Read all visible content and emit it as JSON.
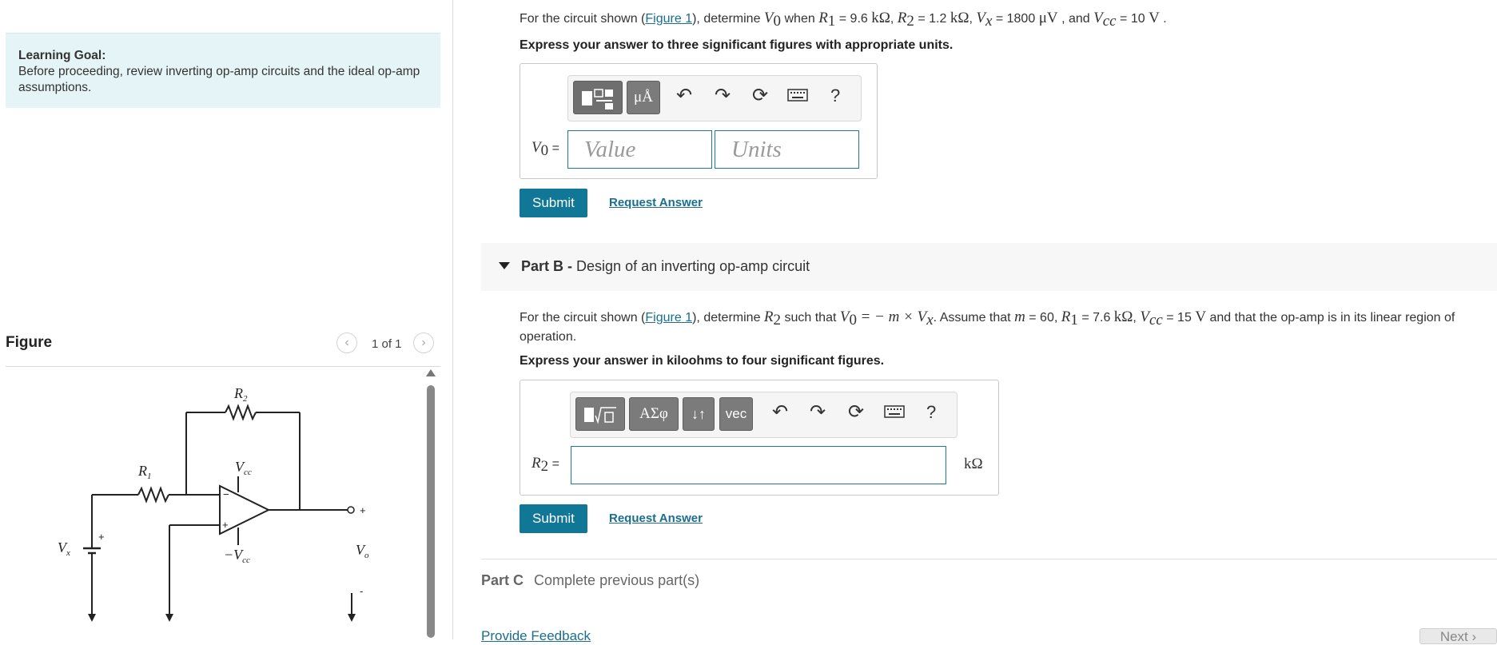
{
  "learning_goal": {
    "title": "Learning Goal:",
    "text": "Before proceeding, review inverting op-amp circuits and the ideal op-amp assumptions."
  },
  "figure": {
    "title": "Figure",
    "counter": "1 of 1",
    "prev_icon": "chevron-left-icon",
    "next_icon": "chevron-right-icon",
    "circuit_labels": {
      "r2": "R",
      "r2_sub": "2",
      "r1": "R",
      "r1_sub": "1",
      "vcc": "V",
      "vcc_sub": "cc",
      "neg_vcc": "−V",
      "neg_vcc_sub": "cc",
      "vx": "V",
      "vx_sub": "x",
      "vo": "V",
      "vo_sub": "o",
      "plus": "+",
      "minus": "−",
      "out_plus": "+",
      "out_minus": "-"
    }
  },
  "part_a": {
    "p_pre": "For the circuit shown (",
    "figure_link": "Figure 1",
    "p_post": "), determine",
    "v0": "V",
    "v0_sub": "0",
    "when": "when",
    "r1": "R",
    "r1_sub": "1",
    "r1_val": "= 9.6",
    "k_ohm": "kΩ",
    "comma": ",",
    "r2": "R",
    "r2_sub": "2",
    "r2_val": "= 1.2",
    "vx": "V",
    "vx_sub": "x",
    "vx_val": "= 1800",
    "micro_v": "μV",
    "and": ", and",
    "vcc": "V",
    "vcc_sub": "cc",
    "vcc_val": "= 10",
    "volt": "V",
    "period": ".",
    "instruction": "Express your answer to three significant figures with appropriate units.",
    "toolbar": {
      "templates_icon": "templates-icon",
      "units_label": "μÅ",
      "undo_icon": "undo-icon",
      "redo_icon": "redo-icon",
      "reset_icon": "reset-icon",
      "keyboard_icon": "keyboard-icon",
      "help_label": "?"
    },
    "label": "V",
    "label_sub": "0",
    "label_eq": "=",
    "value_placeholder": "Value",
    "units_placeholder": "Units",
    "submit_label": "Submit",
    "request_label": "Request Answer"
  },
  "part_b": {
    "header_bold": "Part B -",
    "header_text": "Design of an inverting op-amp circuit",
    "p_pre": "For the circuit shown (",
    "figure_link": "Figure 1",
    "p_post": "), determine",
    "r2": "R",
    "r2_sub": "2",
    "such_that": "such that",
    "v0": "V",
    "v0_sub": "0",
    "eq_expr": "= − m × V",
    "eq_sub": "x",
    "eq_end": ".",
    "assume": "Assume that",
    "m": "m",
    "m_val": "= 60,",
    "r1": "R",
    "r1_sub": "1",
    "r1_val": "= 7.6",
    "k_ohm": "kΩ",
    "comma": ",",
    "vcc": "V",
    "vcc_sub": "cc",
    "vcc_val": "= 15",
    "volt": "V",
    "tail": "and that the op-amp is in its linear region of operation.",
    "instruction": "Express your answer in kiloohms to four significant figures.",
    "toolbar": {
      "templates_icon": "templates-icon",
      "symbols_label": "ΑΣφ",
      "arrows_label": "↓↑",
      "vec_label": "vec",
      "undo_icon": "undo-icon",
      "redo_icon": "redo-icon",
      "reset_icon": "reset-icon",
      "keyboard_icon": "keyboard-icon",
      "help_label": "?"
    },
    "label": "R",
    "label_sub": "2",
    "label_eq": "=",
    "unit": "kΩ",
    "submit_label": "Submit",
    "request_label": "Request Answer"
  },
  "part_c": {
    "label": "Part C",
    "status": "Complete previous part(s)"
  },
  "footer": {
    "feedback": "Provide Feedback",
    "next": "Next ›"
  }
}
